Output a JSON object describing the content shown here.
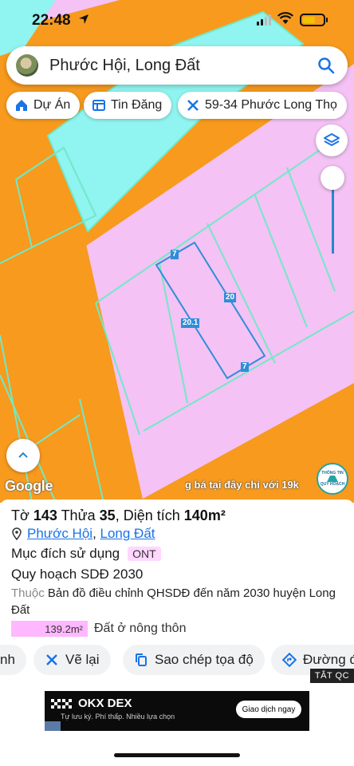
{
  "status_bar": {
    "time": "22:48"
  },
  "search": {
    "text": "Phước Hội, Long Đất"
  },
  "chips": [
    {
      "label": "Dự Án",
      "icon": "house-icon"
    },
    {
      "label": "Tin Đăng",
      "icon": "listing-icon"
    },
    {
      "label": "59-34 Phước Long Thọ",
      "icon": "ruler-icon"
    }
  ],
  "map": {
    "dimensions": {
      "top": "7",
      "right": "20",
      "left": "20.1",
      "bottom": "7"
    },
    "google_logo": "Google",
    "ticker": "g bá tại đây chỉ với 19k",
    "badge": {
      "line1": "THÔNG TIN",
      "line2": "QUY HOẠCH"
    },
    "colors": {
      "residential": "#f4c2f4",
      "road": "#f79a1e",
      "water": "#90f4f0",
      "parcel_line": "#72e8c8",
      "highlight": "#2f8ed8"
    }
  },
  "parcel": {
    "sheet_label": "Tờ",
    "sheet": "143",
    "lot_label": "Thửa",
    "lot": "35",
    "area_label": "Diện tích",
    "area": "140m²",
    "ward": "Phước Hội",
    "district": "Long Đất",
    "purpose_label": "Mục đích sử dụng",
    "purpose_code": "ONT",
    "plan": "Quy hoạch SDĐ 2030",
    "belongs_label": "Thuộc",
    "belongs_text": "Bản đồ điều chỉnh QHSDĐ đến năm 2030 huyện Long Đất",
    "zone_area": "139.2m²",
    "zone_name": "Đất ở nông thôn"
  },
  "actions": {
    "partial_left": "nh",
    "redraw": "Vẽ lại",
    "copy_coords": "Sao chép tọa độ",
    "directions": "Đường đi",
    "ad_close": "TẮT QC"
  },
  "ad": {
    "title": "OKX DEX",
    "subtitle": "Tự lưu ký. Phí thấp. Nhiều lựa chọn",
    "cta": "Giao dịch ngay"
  }
}
